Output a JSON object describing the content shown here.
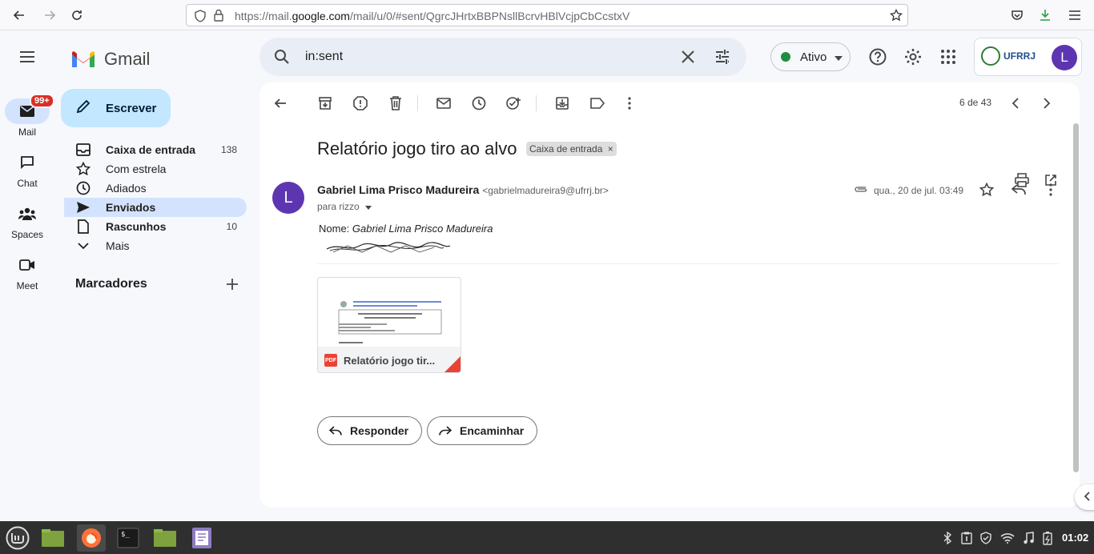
{
  "browser": {
    "url_prefix": "https://mail.",
    "url_host": "google.com",
    "url_path": "/mail/u/0/#sent/QgrcJHrtxBBPNsllBcrvHBlVcjpCbCcstxV"
  },
  "rail": {
    "badge": "99+",
    "items": [
      {
        "label": "Mail",
        "icon": "mail-icon"
      },
      {
        "label": "Chat",
        "icon": "chat-icon"
      },
      {
        "label": "Spaces",
        "icon": "spaces-icon"
      },
      {
        "label": "Meet",
        "icon": "meet-icon"
      }
    ]
  },
  "header": {
    "app_name": "Gmail",
    "search_value": "in:sent",
    "status": "Ativo",
    "account_org": "UFRRJ",
    "avatar_letter": "L"
  },
  "sidebar": {
    "compose_label": "Escrever",
    "items": [
      {
        "label": "Caixa de entrada",
        "count": "138"
      },
      {
        "label": "Com estrela",
        "count": ""
      },
      {
        "label": "Adiados",
        "count": ""
      },
      {
        "label": "Enviados",
        "count": ""
      },
      {
        "label": "Rascunhos",
        "count": "10"
      },
      {
        "label": "Mais",
        "count": ""
      }
    ],
    "labels_heading": "Marcadores"
  },
  "message": {
    "pager": "6 de 43",
    "subject": "Relatório jogo tiro ao alvo",
    "label_chip": "Caixa de entrada",
    "sender_initial": "L",
    "sender_name": "Gabriel Lima Prisco Madureira",
    "sender_email": "<gabrielmadureira9@ufrrj.br>",
    "recipient": "para rizzo",
    "date": "qua., 20 de jul. 03:49",
    "body_prefix": "Nome: ",
    "body_name": "Gabriel Lima Prisco Madureira",
    "attachment_name": "Relatório jogo tir...",
    "attachment_type": "PDF",
    "reply_label": "Responder",
    "forward_label": "Encaminhar"
  },
  "taskbar": {
    "clock": "01:02"
  },
  "colors": {
    "accent": "#0b57d0",
    "compose_bg": "#c2e7ff",
    "active_nav": "#d3e3fd",
    "avatar": "#5e35b1",
    "status_green": "#1e8e3e"
  }
}
